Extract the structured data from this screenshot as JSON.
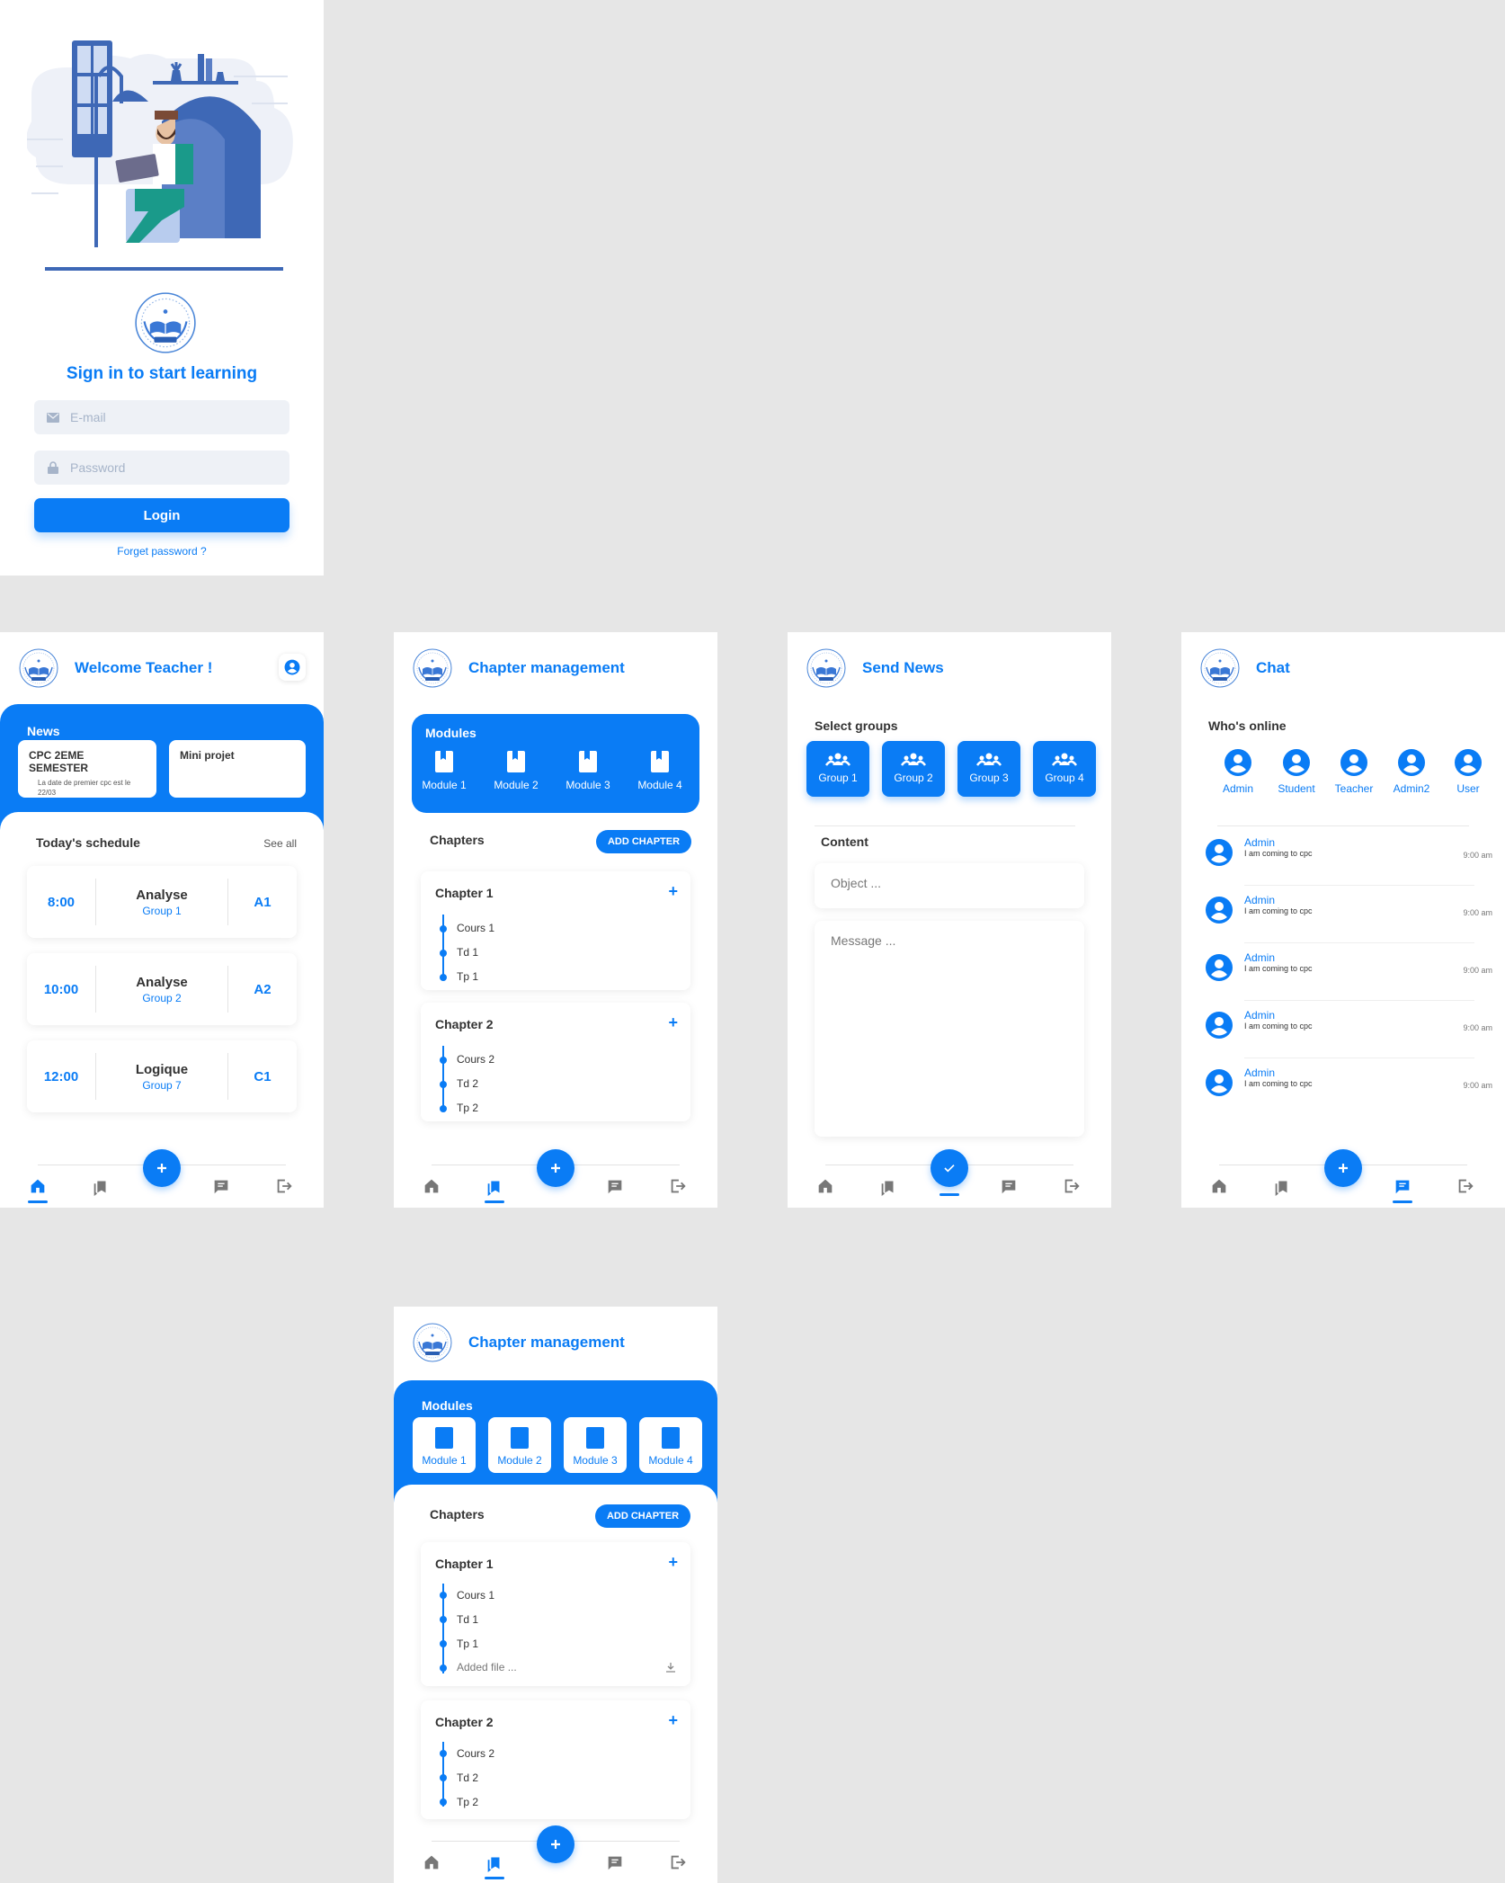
{
  "colors": {
    "accent": "#0a7cf5",
    "background": "#e6e6e6"
  },
  "login": {
    "title": "Sign in to start learning",
    "email_placeholder": "E-mail",
    "password_placeholder": "Password",
    "login_label": "Login",
    "forget_label": "Forget password ?"
  },
  "home": {
    "title": "Welcome Teacher !",
    "news_label": "News",
    "news": [
      {
        "title": "CPC 2EME SEMESTER",
        "text": "La date de premier cpc est le 22/03"
      },
      {
        "title": "Mini projet",
        "text": ""
      }
    ],
    "schedule_title": "Today's schedule",
    "see_all": "See all",
    "schedule": [
      {
        "time": "8:00",
        "subject": "Analyse",
        "group": "Group 1",
        "room": "A1"
      },
      {
        "time": "10:00",
        "subject": "Analyse",
        "group": "Group 2",
        "room": "A2"
      },
      {
        "time": "12:00",
        "subject": "Logique",
        "group": "Group 7",
        "room": "C1"
      }
    ]
  },
  "chapter": {
    "title": "Chapter management",
    "modules_label": "Modules",
    "modules": [
      "Module 1",
      "Module 2",
      "Module 3",
      "Module 4"
    ],
    "chapters_label": "Chapters",
    "add_label": "ADD CHAPTER",
    "chapters": [
      {
        "name": "Chapter 1",
        "items": [
          "Cours 1",
          "Td 1",
          "Tp 1"
        ]
      },
      {
        "name": "Chapter 2",
        "items": [
          "Cours 2",
          "Td 2",
          "Tp 2"
        ]
      }
    ],
    "added_file": "Added file ..."
  },
  "send_news": {
    "title": "Send News",
    "select_label": "Select groups",
    "groups": [
      "Group 1",
      "Group 2",
      "Group 3",
      "Group 4"
    ],
    "content_label": "Content",
    "object_placeholder": "Object ...",
    "message_placeholder": "Message ..."
  },
  "chat": {
    "title": "Chat",
    "online_label": "Who's online",
    "online": [
      "Admin",
      "Student",
      "Teacher",
      "Admin2",
      "User"
    ],
    "messages": [
      {
        "name": "Admin",
        "text": "I am coming to cpc",
        "time": "9:00 am"
      },
      {
        "name": "Admin",
        "text": "I am coming to cpc",
        "time": "9:00 am"
      },
      {
        "name": "Admin",
        "text": "I am coming to cpc",
        "time": "9:00 am"
      },
      {
        "name": "Admin",
        "text": "I am coming to cpc",
        "time": "9:00 am"
      },
      {
        "name": "Admin",
        "text": "I am coming to cpc",
        "time": "9:00 am"
      }
    ]
  },
  "nav_icons": [
    "home-icon",
    "bookmark-icon",
    "add-icon",
    "chat-icon",
    "logout-icon"
  ]
}
